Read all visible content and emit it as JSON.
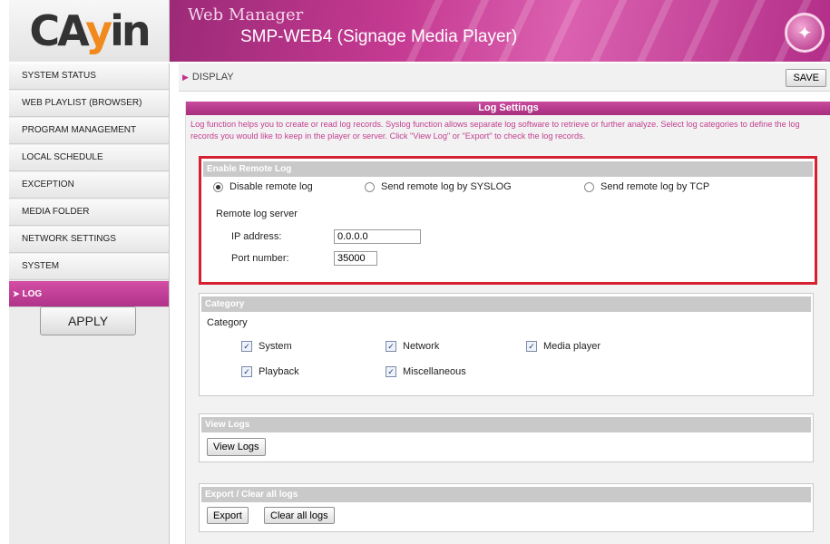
{
  "logo": {
    "text_a": "CA",
    "text_b": "y",
    "text_c": "in"
  },
  "header": {
    "title": "Web Manager",
    "subtitle": "SMP-WEB4 (Signage Media Player)",
    "badge_icon": "star-wand-icon"
  },
  "sidebar": {
    "items": [
      {
        "label": "SYSTEM STATUS"
      },
      {
        "label": "WEB PLAYLIST (BROWSER)"
      },
      {
        "label": "PROGRAM MANAGEMENT"
      },
      {
        "label": "LOCAL SCHEDULE"
      },
      {
        "label": "EXCEPTION"
      },
      {
        "label": "MEDIA FOLDER"
      },
      {
        "label": "NETWORK SETTINGS"
      },
      {
        "label": "SYSTEM"
      },
      {
        "label": "LOG",
        "active": true
      }
    ],
    "apply_label": "APPLY"
  },
  "topbar": {
    "breadcrumb": "DISPLAY",
    "save_label": "SAVE"
  },
  "log_settings": {
    "title": "Log Settings",
    "description": "Log function helps you to create or read log records. Syslog function allows separate log software to retrieve or further analyze. Select log categories to define the log records you would like to keep in the player or server. Click \"View Log\" or \"Export\" to check the log records."
  },
  "remote_log": {
    "title": "Enable Remote Log",
    "options": [
      "Disable remote log",
      "Send remote log by SYSLOG",
      "Send remote log by TCP"
    ],
    "selected": "Disable remote log",
    "server_label": "Remote log server",
    "ip_label": "IP address:",
    "ip_value": "0.0.0.0",
    "port_label": "Port number:",
    "port_value": "35000"
  },
  "category": {
    "title": "Category",
    "label": "Category",
    "items": [
      "System",
      "Network",
      "Media player",
      "Playback",
      "Miscellaneous"
    ]
  },
  "view_logs": {
    "title": "View Logs",
    "button": "View Logs"
  },
  "export": {
    "title": "Export / Clear all logs",
    "export_button": "Export",
    "clear_button": "Clear all logs"
  },
  "colors": {
    "accent": "#b8338c",
    "highlight_border": "#d4202f"
  }
}
